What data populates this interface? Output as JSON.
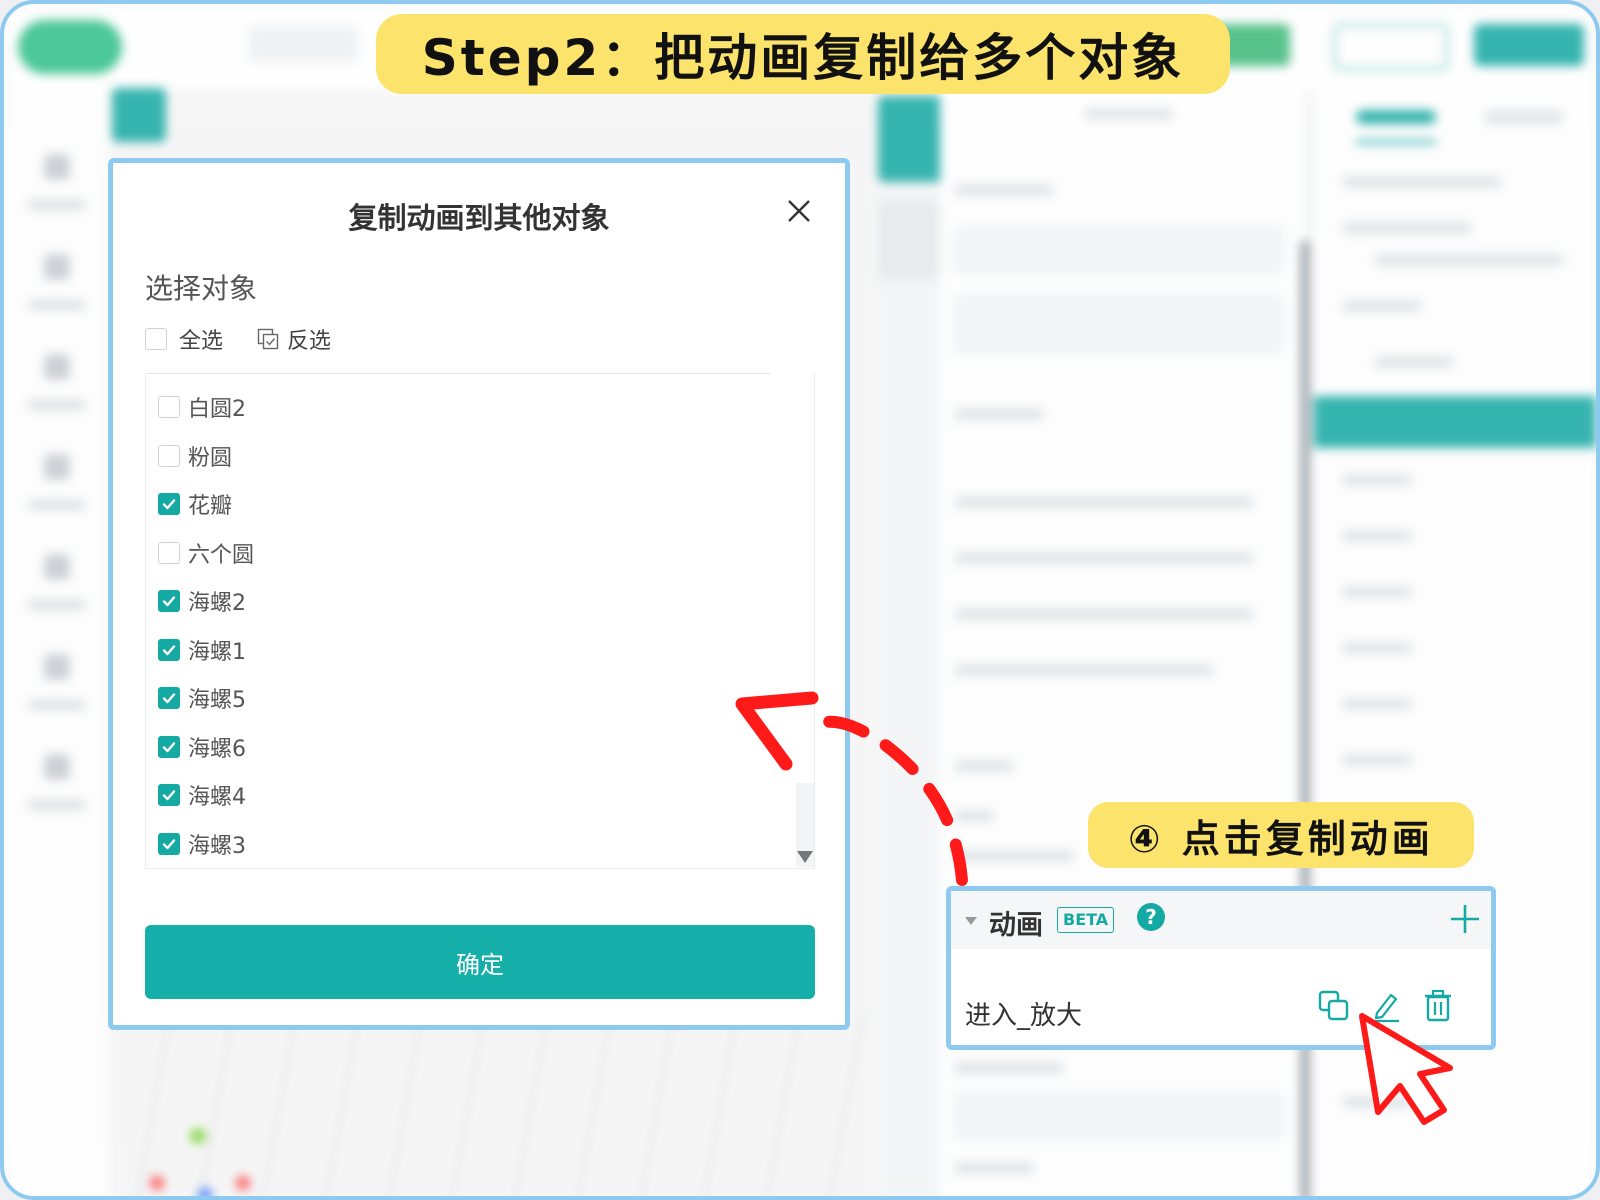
{
  "banner": {
    "title": "Step2：把动画复制给多个对象"
  },
  "dialog": {
    "title": "复制动画到其他对象",
    "section_label": "选择对象",
    "select_all_label": "全选",
    "invert_label": "反选",
    "items": [
      {
        "label": "白圆2",
        "checked": false
      },
      {
        "label": "粉圆",
        "checked": false
      },
      {
        "label": "花瓣",
        "checked": true
      },
      {
        "label": "六个圆",
        "checked": false
      },
      {
        "label": "海螺2",
        "checked": true
      },
      {
        "label": "海螺1",
        "checked": true
      },
      {
        "label": "海螺5",
        "checked": true
      },
      {
        "label": "海螺6",
        "checked": true
      },
      {
        "label": "海螺4",
        "checked": true
      },
      {
        "label": "海螺3",
        "checked": true
      }
    ],
    "confirm_label": "确定"
  },
  "step_callout": {
    "text": "④ 点击复制动画"
  },
  "animation_panel": {
    "title": "动画",
    "badge": "BETA",
    "help_symbol": "?",
    "item_name": "进入_放大"
  },
  "colors": {
    "accent": "#15a9a3",
    "highlight_border": "#8ec9ef",
    "banner_yellow": "#fbe36c",
    "annotation_red": "#ff1a1a"
  },
  "icons": {
    "close": "close-icon",
    "invert": "invert-select-icon",
    "check": "checkmark-icon",
    "add": "plus-icon",
    "copy": "copy-icon",
    "edit": "pencil-icon",
    "delete": "trash-icon",
    "pointer": "cursor-arrow-icon"
  }
}
